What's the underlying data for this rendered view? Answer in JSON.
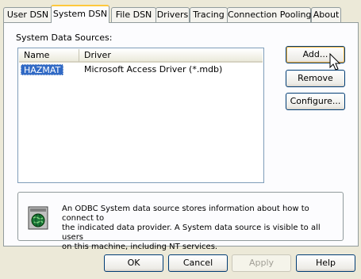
{
  "tabs": [
    {
      "label": "User DSN"
    },
    {
      "label": "System DSN"
    },
    {
      "label": "File DSN"
    },
    {
      "label": "Drivers"
    },
    {
      "label": "Tracing"
    },
    {
      "label": "Connection Pooling"
    },
    {
      "label": "About"
    }
  ],
  "group_label": "System Data Sources:",
  "list": {
    "columns": [
      "Name",
      "Driver"
    ],
    "rows": [
      {
        "name": "HAZMAT",
        "driver": "Microsoft Access Driver (*.mdb)"
      }
    ]
  },
  "side_buttons": {
    "add": "Add...",
    "remove": "Remove",
    "configure": "Configure..."
  },
  "info": {
    "line1": "An ODBC System data source stores information about how to connect to",
    "line2": "the indicated data provider.   A System data source is visible to all users",
    "line3": "on this machine, including NT services."
  },
  "bottom_buttons": {
    "ok": "OK",
    "cancel": "Cancel",
    "apply": "Apply",
    "help": "Help"
  }
}
